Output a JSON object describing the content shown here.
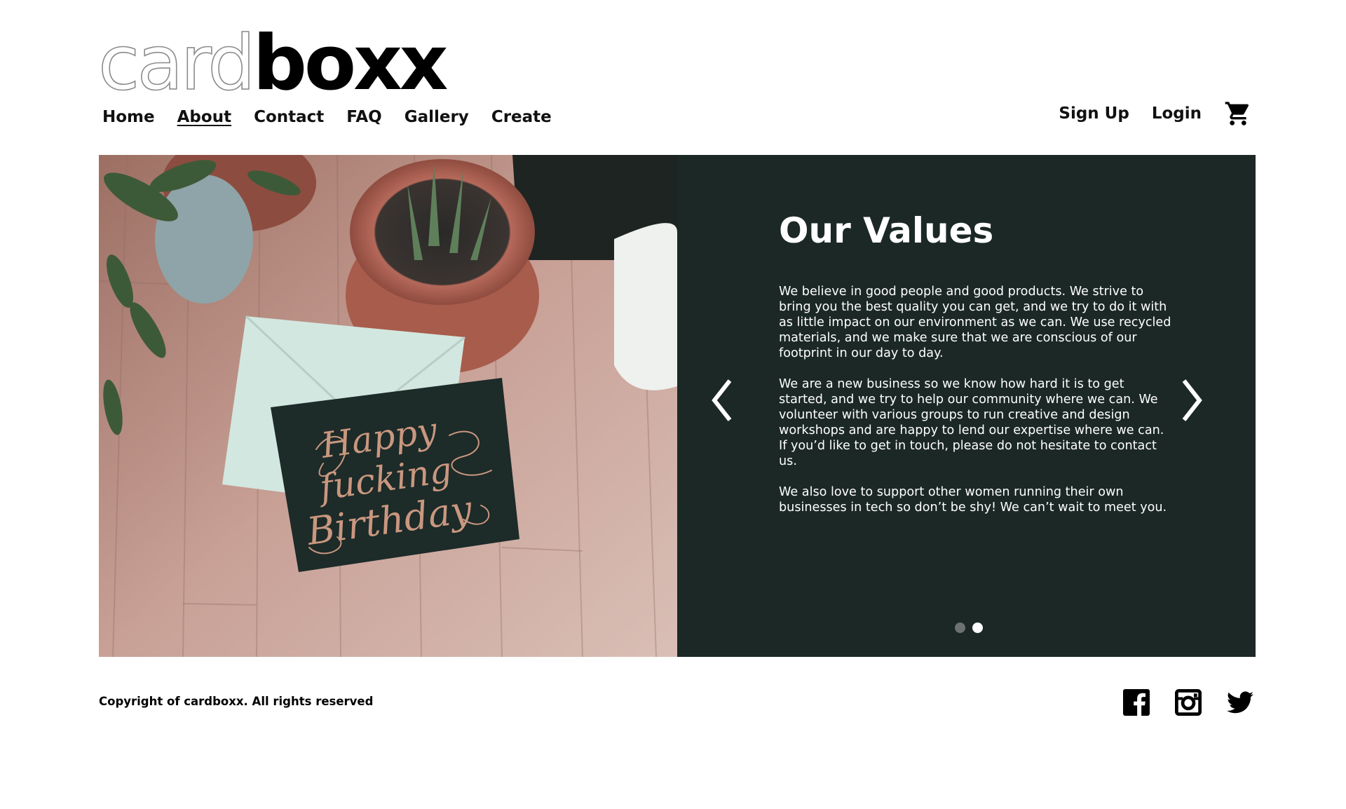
{
  "brand": {
    "light": "card",
    "bold": "boxx"
  },
  "nav": {
    "items": [
      {
        "label": "Home"
      },
      {
        "label": "About"
      },
      {
        "label": "Contact"
      },
      {
        "label": "FAQ"
      },
      {
        "label": "Gallery"
      },
      {
        "label": "Create"
      }
    ],
    "active": "About"
  },
  "account": {
    "signup_label": "Sign Up",
    "login_label": "Login",
    "cart_icon": "shopping-cart-icon"
  },
  "hero": {
    "image": {
      "subject": "greeting-card-photo",
      "card_lines": [
        "Happy",
        "fucking",
        "Birthday"
      ]
    },
    "panel": {
      "title": "Our Values",
      "paragraphs": [
        "We believe in good people and good products. We strive to bring you the best quality you can get, and we try to do it with as little impact on our environment as we can. We use recycled materials, and we make sure that we are conscious of our footprint in our day to day.",
        "We are a new business so we know how hard it is to get started, and we try to help our community where we can. We volunteer with various groups to run creative and design workshops and are happy to lend our expertise where we can. If you’d like to get in touch, please do not hesitate to contact us.",
        "We also love to support other women running their own businesses in tech so don’t be shy! We can’t wait to meet you."
      ],
      "prev_icon": "chevron-left-icon",
      "next_icon": "chevron-right-icon",
      "slides_total": 2,
      "slide_active": 2,
      "background_color": "#1b2826"
    }
  },
  "footer": {
    "copyright": "Copyright of cardboxx. All rights reserved",
    "social": [
      "facebook-icon",
      "instagram-icon",
      "twitter-icon"
    ]
  }
}
